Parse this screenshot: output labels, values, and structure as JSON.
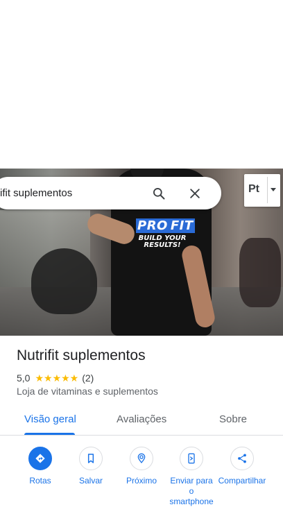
{
  "search": {
    "query": "ifit suplementos"
  },
  "layer_button": {
    "label": "Pt"
  },
  "place": {
    "name": "Nutrifit suplementos",
    "rating": "5,0",
    "stars": "★★★★★",
    "review_count": "(2)",
    "category": "Loja de vitaminas e suplementos"
  },
  "photo": {
    "shirt_brand_a": "PRO",
    "shirt_brand_b": "FIT",
    "shirt_slogan": "BUILD YOUR RESULTS!"
  },
  "tabs": [
    {
      "label": "Visão geral",
      "active": true
    },
    {
      "label": "Avaliações",
      "active": false
    },
    {
      "label": "Sobre",
      "active": false
    }
  ],
  "actions": [
    {
      "label": "Rotas",
      "icon": "directions-icon"
    },
    {
      "label": "Salvar",
      "icon": "bookmark-icon"
    },
    {
      "label": "Próximo",
      "icon": "nearby-icon"
    },
    {
      "label": "Enviar para o smartphone",
      "icon": "send-to-phone-icon"
    },
    {
      "label": "Compartilhar",
      "icon": "share-icon"
    }
  ],
  "colors": {
    "accent": "#1a73e8",
    "star": "#fbbc04"
  }
}
